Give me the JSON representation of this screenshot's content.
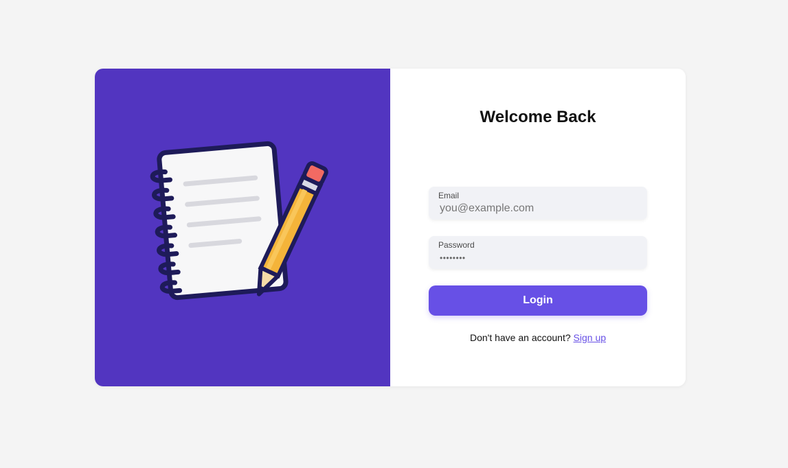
{
  "colors": {
    "page_background": "#f4f4f4",
    "left_panel": "#5235c0",
    "accent": "#6750e6",
    "field_background": "#f1f2f6"
  },
  "illustration": {
    "icon": "notebook-and-pencil-icon"
  },
  "login_form": {
    "title": "Welcome Back",
    "email": {
      "label": "Email",
      "placeholder": "you@example.com",
      "value": ""
    },
    "password": {
      "label": "Password",
      "masked_value": "••••••••"
    },
    "login_label": "Login",
    "signup_prompt": "Don't have an account?",
    "signup_link": "Sign up"
  }
}
